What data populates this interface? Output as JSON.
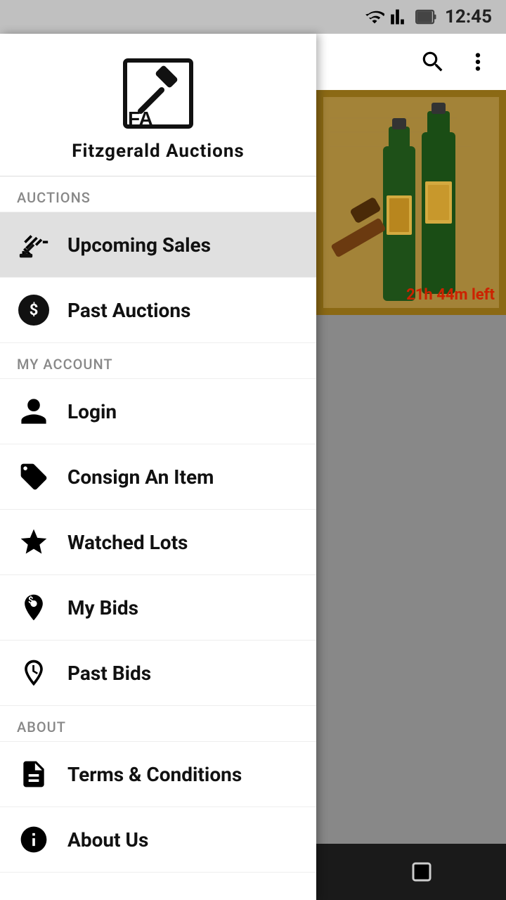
{
  "app": {
    "name": "Fitzgerald Auctions",
    "logo_alt": "FA Auction Logo"
  },
  "status_bar": {
    "time": "12:45"
  },
  "header": {
    "search_icon": "search-icon",
    "more_icon": "more-icon"
  },
  "auction_card": {
    "time_remaining": "21h 44m left"
  },
  "sections": {
    "auctions_label": "AUCTIONS",
    "my_account_label": "MY ACCOUNT",
    "about_label": "ABOUT"
  },
  "menu": {
    "upcoming_sales": "Upcoming Sales",
    "past_auctions": "Past Auctions",
    "login": "Login",
    "consign_an_item": "Consign An Item",
    "watched_lots": "Watched Lots",
    "my_bids": "My Bids",
    "past_bids": "Past Bids",
    "terms_conditions": "Terms & Conditions",
    "about_us": "About Us"
  },
  "nav": {
    "back": "◁",
    "home": "○",
    "recent": "□"
  }
}
